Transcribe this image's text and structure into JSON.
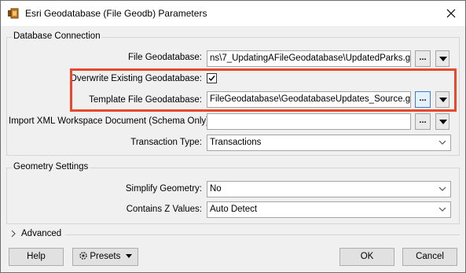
{
  "window": {
    "title": "Esri Geodatabase (File Geodb) Parameters"
  },
  "database_connection": {
    "group_title": "Database Connection",
    "file_geodatabase_label": "File Geodatabase:",
    "file_geodatabase_value": "ns\\7_UpdatingAFileGeodatabase\\UpdatedParks.gdb\"",
    "overwrite_label": "Overwrite Existing Geodatabase:",
    "overwrite_checked": true,
    "template_label": "Template File Geodatabase:",
    "template_value": "FileGeodatabase\\GeodatabaseUpdates_Source.gdb\"",
    "import_xml_label": "Import XML Workspace Document (Schema Only):",
    "import_xml_value": "",
    "transaction_type_label": "Transaction Type:",
    "transaction_type_value": "Transactions",
    "browse_label": "..."
  },
  "geometry_settings": {
    "group_title": "Geometry Settings",
    "simplify_label": "Simplify Geometry:",
    "simplify_value": "No",
    "contains_z_label": "Contains Z Values:",
    "contains_z_value": "Auto Detect"
  },
  "advanced": {
    "label": "Advanced"
  },
  "footer": {
    "help_label": "Help",
    "presets_label": "Presets",
    "ok_label": "OK",
    "cancel_label": "Cancel"
  },
  "colors": {
    "highlight": "#e8482c",
    "active_button_border": "#3a7bd5"
  }
}
